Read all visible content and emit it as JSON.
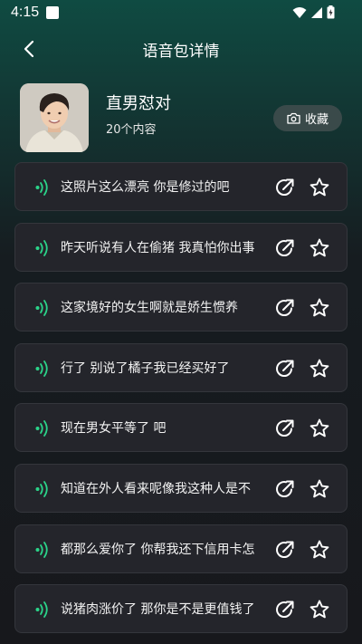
{
  "status": {
    "time": "4:15"
  },
  "header": {
    "title": "语音包详情"
  },
  "pack": {
    "name": "直男怼对",
    "count": "20个内容",
    "fav_label": "收藏"
  },
  "items": [
    {
      "text": "这照片这么漂亮 你是修过的吧"
    },
    {
      "text": "昨天听说有人在偷猪 我真怕你出事"
    },
    {
      "text": "这家境好的女生啊就是娇生惯养"
    },
    {
      "text": "行了 别说了橘子我已经买好了"
    },
    {
      "text": "现在男女平等了 吧"
    },
    {
      "text": "知道在外人看来呢像我这种人是不"
    },
    {
      "text": "都那么爱你了 你帮我还下信用卡怎"
    },
    {
      "text": "说猪肉涨价了 那你是不是更值钱了"
    }
  ],
  "colors": {
    "accent_wave": "#2bd48a",
    "fav_bg": "#3a4a4a",
    "item_bg": "#24252b"
  },
  "icons": [
    "back-arrow-icon",
    "camera-icon",
    "sound-wave-icon",
    "share-icon",
    "star-icon",
    "wifi-icon",
    "signal-icon",
    "battery-icon"
  ]
}
